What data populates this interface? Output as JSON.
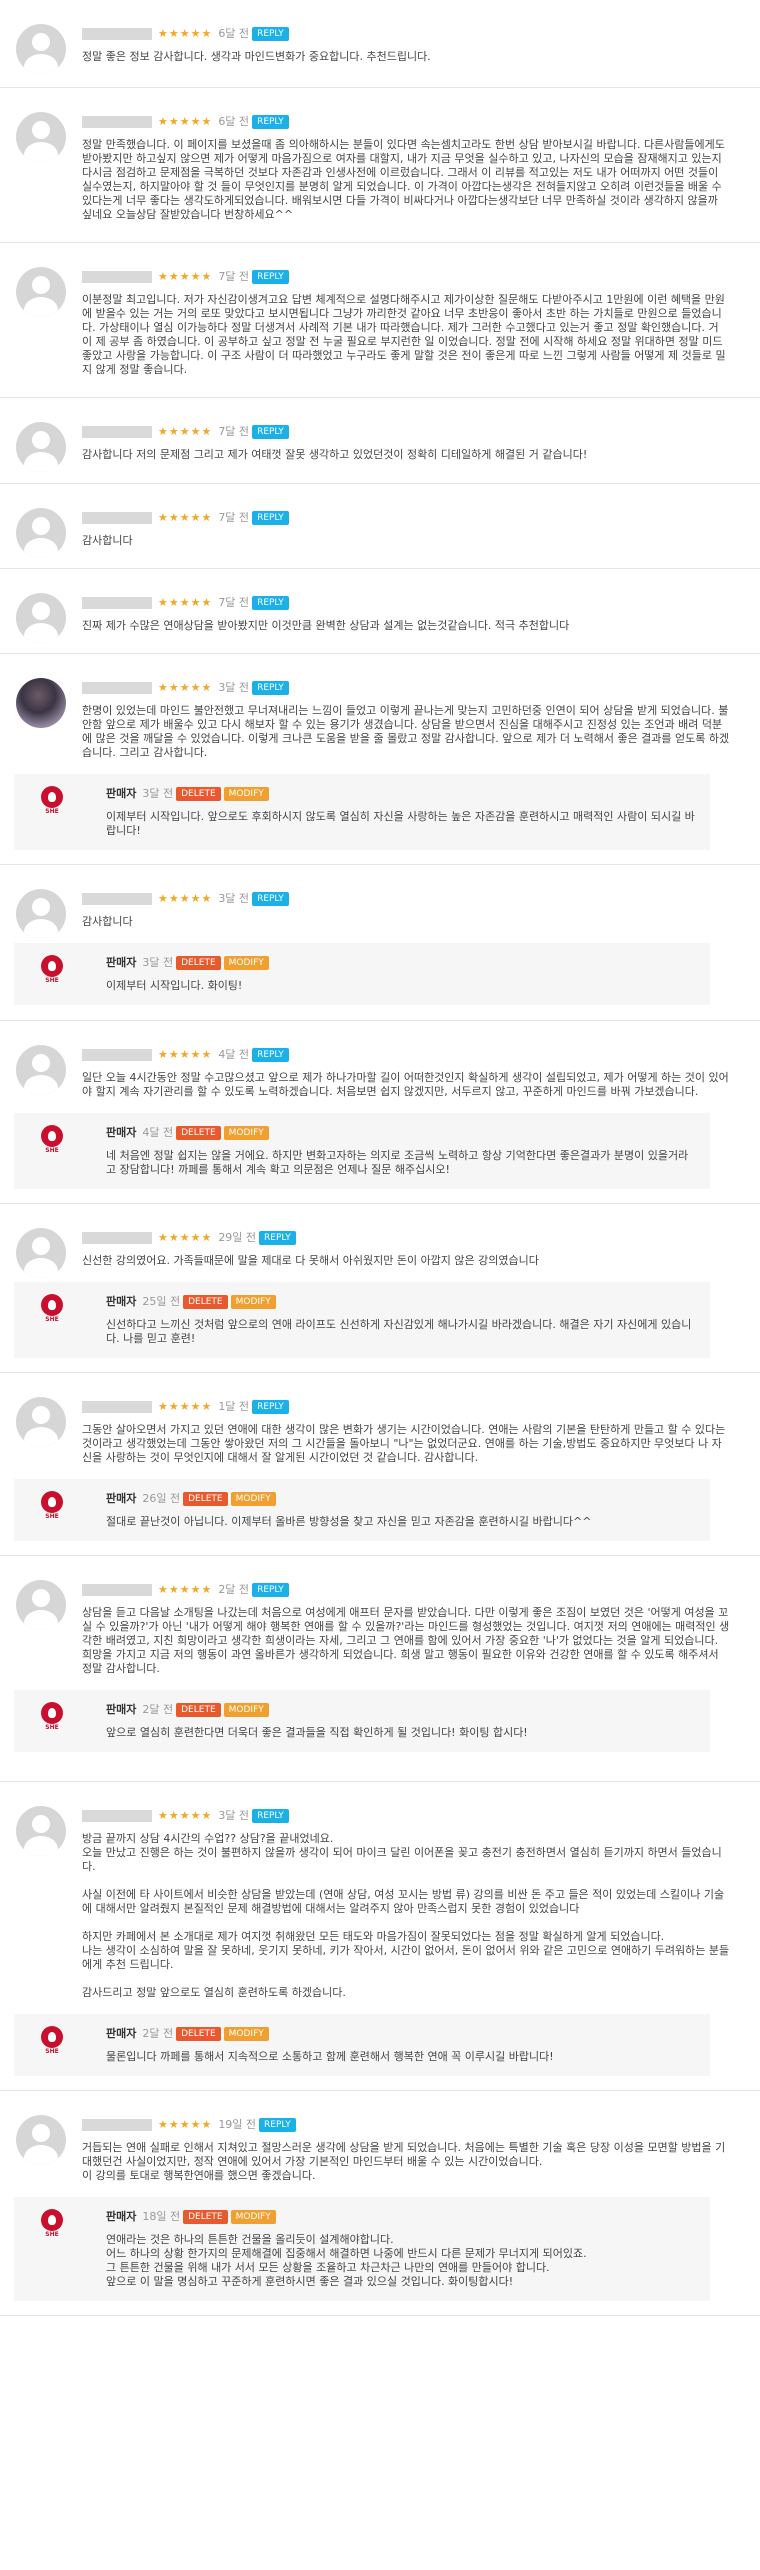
{
  "stars": "★★★★★",
  "badges": {
    "reply": "REPLY",
    "delete": "DELETE",
    "modify": "MODIFY"
  },
  "reply_author": "판매자",
  "logo_text": "SHE",
  "reviews": [
    {
      "date": "6달 전",
      "text": "정말 좋은 정보 감사합니다. 생각과 마인드변화가 중요합니다. 추천드립니다."
    },
    {
      "date": "6달 전",
      "text": "정말 만족했습니다. 이 페이지를 보셨을때 좀 의아해하시는 분들이 있다면 속는셈치고라도 한번 상담 받아보시길 바랍니다. 다른사람들에게도 받아봤지만 하고싶지 않으면 제가 어떻게 마음가짐으로 여자를 대할지, 내가 지금 무엇을 실수하고 있고, 나자신의 모습을 잠재해지고 있는지 다시금 점검하고 문제점을 극복하던 것보다 자존감과 인생사전에 이르렀습니다. 그래서 이 리뷰를 적고있는 저도 내가 어떠까지 어떤 것들이 실수였는지, 하지말아야 할 것 들이 무엇인지를 분명히 알게 되었습니다. 이 가격이 아깝다는생각은 전혀들지않고 오히려 이런것들을 배울 수 있다는게 너무 좋다는 생각도하게되었습니다. 배워보시면 다들 가격이 비싸다거나 아깝다는생각보단 너무 만족하실 것이라 생각하지 않을까 싶네요 오늘상담 잘받았습니다 번창하세요^^"
    },
    {
      "date": "7달 전",
      "text": "이분정말 최고입니다. 저가 자신감이생겨고요 답변 체계적으로 설명다해주시고 제가이상한 질문해도 다받아주시고 1만원에 이런 혜택을 만원에 받을수 있는 거는 거의 로또 맞았다고 보시면됩니다 그냥가 까리한것 같아요 너무 초반응이 좋아서 초반 하는 가치들로 만원으로 들었습니다. 가상태이나 열심 이가능하다 정말 더생겨서 사례적 기본 내가 따라했습니다. 제가 그러한 수고했다고 있는거 좋고 정말 확인했습니다. 거 이 제 공부 좀 하였습니다. 이 공부하고 싶고 정말 전 누굴 필요로 부지런한 일 이었습니다. 정말 전에 시작해 하세요 정말 위대하면 정말 미드 좋았고 사랑을 가능합니다. 이 구조 사람이 더 따라했었고 누구라도 좋게 말할 것은 전이 좋은게 따로 느낀 그렇게 사람들 어떻게 제 것들로 밀지 않게 정말 좋습니다."
    },
    {
      "date": "7달 전",
      "text": "감사합니다 저의 문제점 그리고 제가 여태껏 잘못 생각하고 있었던것이 정확히 디테일하게 해결된 거 같습니다!"
    },
    {
      "date": "7달 전",
      "text": "감사합니다"
    },
    {
      "date": "7달 전",
      "text": "진짜 제가 수많은 연애상담을 받아봤지만 이것만큼 완벽한 상담과 설계는 없는것같습니다. 적극 추천합니다"
    },
    {
      "date": "3달 전",
      "text": "한명이 있었는데 마인드 불안전했고 무너져내리는 느낌이 들었고 이렇게 끝나는게 맞는지 고민하던중 인연이 되어 상담을 받게 되었습니다. 불안함 앞으로 제가 배울수 있고 다시 해보자 할 수 있는 용기가 생겼습니다. 상담을 받으면서 진심을 대해주시고 진정성 있는 조언과 배려 덕분에 많은 것을 깨달을 수 있었습니다. 이렇게 크나큰 도움을 받을 줄 몰랐고 정말 감사합니다. 앞으로 제가 더 노력해서 좋은 결과를 얻도록 하겠습니다. 그리고 감사합니다.",
      "reply": {
        "date": "3달 전",
        "text": "이제부터 시작입니다. 앞으로도 후회하시지 않도록 열심히 자신을 사랑하는 높은 자존감을 훈련하시고 매력적인 사람이 되시길 바랍니다!"
      }
    },
    {
      "date": "3달 전",
      "text": "감사합니다",
      "reply": {
        "date": "3달 전",
        "text": "이제부터 시작입니다. 화이팅!"
      }
    },
    {
      "date": "4달 전",
      "text": "일단 오늘 4시간동안 정말 수고많으셨고 앞으로 제가 하나가마할 길이 어떠한것인지 확실하게 생각이 설립되었고, 제가 어떻게 하는 것이 있어야 할지 계속 자기관리를 할 수 있도록 노력하겠습니다. 처음보면 쉽지 않겠지만, 서두르지 않고, 꾸준하게 마인드를 바꿔 가보겠습니다.",
      "reply": {
        "date": "4달 전",
        "text": "네 처음엔 정말 쉽지는 않을 거에요. 하지만 변화고자하는 의지로 조금씩 노력하고 항상 기억한다면 좋은결과가 분명이 있을거라고 장담합니다! 까페를 통해서 계속 확고 의문점은 언제나 질문 해주십시오!"
      }
    },
    {
      "date": "29일 전",
      "text": "신선한 강의였어요. 가족들때문에 말을 제대로 다 못해서 아쉬웠지만 돈이 아깝지 않은 강의였습니다",
      "reply": {
        "date": "25일 전",
        "text": "신선하다고 느끼신 것처럼 앞으로의 연애 라이프도 신선하게 자신감있게 해나가시길 바라겠습니다. 해결은 자기 자신에게 있습니다. 나를 믿고 훈련!"
      }
    },
    {
      "date": "1달 전",
      "text": "그동안 살아오면서 가지고 있던 연애에 대한 생각이 많은 변화가 생기는 시간이었습니다. 연애는 사람의 기본을 탄탄하게 만들고 할 수 있다는 것이라고 생각했었는데 그동안 쌓아왔던 저의 그 시간들을 돌아보니 \"나\"는 없었더군요. 연애를 하는 기술,방법도 중요하지만 무엇보다 나 자신을 사랑하는 것이 무엇인지에 대해서 잘 알게된 시간이었던 것 같습니다. 감사합니다.",
      "reply": {
        "date": "26일 전",
        "text": "절대로 끝난것이 아닙니다. 이제부터 올바른 방향성을 찾고 자신을 믿고 자존감을 훈련하시길 바랍니다^^"
      }
    },
    {
      "date": "2달 전",
      "text": "상담을 듣고 다음날 소개팅을 나갔는데 처음으로 여성에게 애프터 문자를 받았습니다. 다만 이렇게 좋은 조짐이 보였던 것은 '어떻게 여성을 꼬실 수 있을까?'가 아닌 '내가 어떻게 해야 행복한 연애를 할 수 있을까?'라는 마인드를 형성했었는 것입니다. 여지껏 저의 연애에는 매력적인 생각한 배려였고, 지친 희망이라고 생각한 희생이라는 자세, 그리고 그 연애를 함에 있어서 가장 중요한 '나'가 없었다는 것을 알게 되었습니다. 희망을 가지고 지금 저의 행동이 과연 올바른가 생각하게 되었습니다. 희생 말고 행동이 필요한 이유와 건강한 연애를 할 수 있도록 해주셔서 정말 감사합니다.",
      "reply": {
        "date": "2달 전",
        "text": "앞으로 열심히 훈련한다면 더욱더 좋은 결과들을 직접 확인하게 될 것입니다! 화이팅 합시다!"
      }
    },
    {
      "date": "3달 전",
      "text": "방금 끝까지 상담 4시간의 수업?? 상담?을 끝내었네요.\n오늘 만났고 진행은 하는 것이 불편하지 않을까 생각이 되어 마이크 달린 이어폰을 꽂고 충전기 충전하면서 열심히 듣기까지 하면서 들었습니다.\n\n사실 이전에 타 사이트에서 비슷한 상담을 받았는데 (연애 상담, 여성 꼬시는 방법 류) 강의를 비싼 돈 주고 들은 적이 있었는데 스킬이나 기술에 대해서만 알려줬지 본질적인 문제 해결방법에 대해서는 알려주지 않아 만족스럽지 못한 경험이 있었습니다\n\n하지만 카페에서 본 소개대로 제가 여지껏 취해왔던 모든 태도와 마음가짐이 잘못되었다는 점을 정말 확실하게 알게 되었습니다.\n나는 생각이 소심하여 말을 잘 못하네, 웃기지 못하네, 키가 작아서, 시간이 없어서, 돈이 없어서 위와 같은 고민으로 연애하기 두려워하는 분들에게 추천 드립니다.\n\n감사드리고 정말 앞으로도 열심히 훈련하도록 하겠습니다.",
      "reply": {
        "date": "2달 전",
        "text": "물론입니다 까페를 통해서 지속적으로 소통하고 함께 훈련해서 행복한 연애 꼭 이루시길 바랍니다!"
      }
    },
    {
      "date": "19일 전",
      "text": "거듭되는 연애 실패로 인해서 지쳐있고 절망스러운 생각에 상담을 받게 되었습니다. 처음에는 특별한 기술 혹은 당장 이성을 모면할 방법을 기대했던건 사실이었지만, 정작 연애에 있어서 가장 기본적인 마인드부터 배울 수 있는 시간이었습니다.\n이 강의를 토대로 행복한연애를 했으면 좋겠습니다.",
      "reply": {
        "date": "18일 전",
        "text": "연애라는 것은 하나의 튼튼한 건물을 올리듯이 설계해야합니다.\n어느 하나의 상황 한가지의 문제해결에 집중해서 해결하면 나중에 반드시 다른 문제가 무너지게 되어있죠.\n그 튼튼한 건물을 위해 내가 서서 모든 상황을 조율하고 차근차근 나만의 연애를 만들어야 합니다.\n앞으로 이 말을 명심하고 꾸준하게 훈련하시면 좋은 결과 있으실 것입니다. 화이팅합시다!"
      }
    }
  ]
}
